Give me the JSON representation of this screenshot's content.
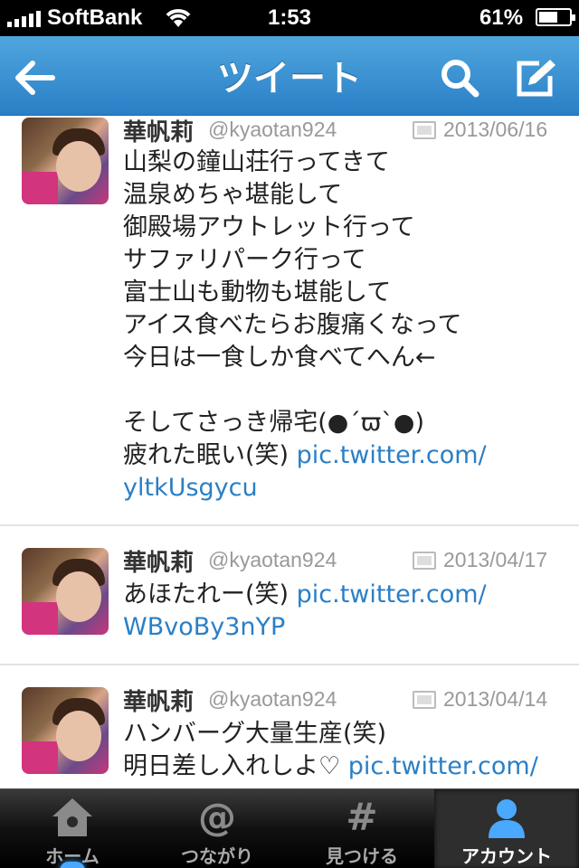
{
  "status_bar": {
    "carrier": "SoftBank",
    "time": "1:53",
    "battery": "61%",
    "battery_level": 0.61
  },
  "nav": {
    "title": "ツイート"
  },
  "tweets": [
    {
      "name": "華帆莉",
      "handle": "@kyaotan924",
      "date": "2013/06/16",
      "text": "山梨の鐘山荘行ってきて\n温泉めちゃ堪能して\n御殿場アウトレット行って\nサファリパーク行って\n富士山も動物も堪能して\nアイス食べたらお腹痛くなって\n今日は一食しか食べてへん←\n\nそしてさっき帰宅(●´ϖ`●)\n疲れた眠い(笑) ",
      "link": "pic.twitter.com/\nyltkUsgycu"
    },
    {
      "name": "華帆莉",
      "handle": "@kyaotan924",
      "date": "2013/04/17",
      "text": "あほたれー(笑) ",
      "link": "pic.twitter.com/\nWBvoBy3nYP"
    },
    {
      "name": "華帆莉",
      "handle": "@kyaotan924",
      "date": "2013/04/14",
      "text": "ハンバーグ大量生産(笑)\n明日差し入れしよ♡ ",
      "link": "pic.twitter.com/"
    }
  ],
  "tab_bar": {
    "tabs": [
      {
        "label": "ホーム",
        "icon": "home-icon"
      },
      {
        "label": "つながり",
        "icon": "at-icon",
        "glyph": "@"
      },
      {
        "label": "見つける",
        "icon": "hash-icon",
        "glyph": "#"
      },
      {
        "label": "アカウント",
        "icon": "person-icon",
        "active": true
      }
    ]
  },
  "colors": {
    "nav_blue": "#2a7fc6",
    "link_blue": "#2a7fc6",
    "active_indicator": "#4aa8ff"
  }
}
